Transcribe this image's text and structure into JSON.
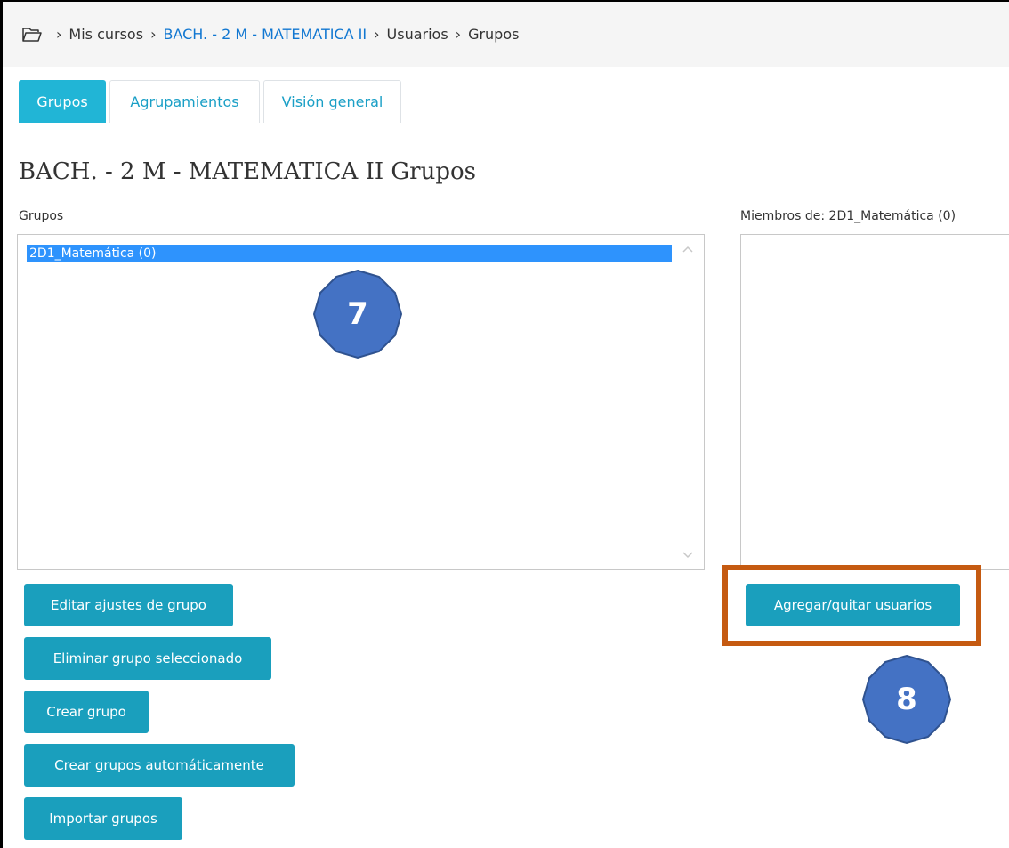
{
  "breadcrumb": {
    "items": [
      "Mis cursos",
      "BACH. - 2 M - MATEMATICA II",
      "Usuarios",
      "Grupos"
    ]
  },
  "tabs": [
    {
      "label": "Grupos",
      "active": true
    },
    {
      "label": "Agrupamientos",
      "active": false
    },
    {
      "label": "Visión general",
      "active": false
    }
  ],
  "page": {
    "title": "BACH. - 2 M - MATEMATICA II Grupos"
  },
  "groups_panel": {
    "label": "Grupos",
    "options": [
      "2D1_Matemática (0)"
    ]
  },
  "members_panel": {
    "label": "Miembros de: 2D1_Matemática (0)"
  },
  "buttons": {
    "edit_group": "Editar ajustes de grupo",
    "delete_group": "Eliminar grupo seleccionado",
    "create_group": "Crear grupo",
    "auto_create": "Crear grupos automáticamente",
    "import_groups": "Importar grupos",
    "add_remove_users": "Agregar/quitar usuarios"
  },
  "annotations": {
    "step_7": "7",
    "step_8": "8"
  },
  "colors": {
    "accent": "#1a9fbd",
    "tab_active": "#21b5d6",
    "link": "#1177d1",
    "selection": "#2e93fd",
    "badge_fill": "#4472c4",
    "highlight": "#c55a11"
  }
}
